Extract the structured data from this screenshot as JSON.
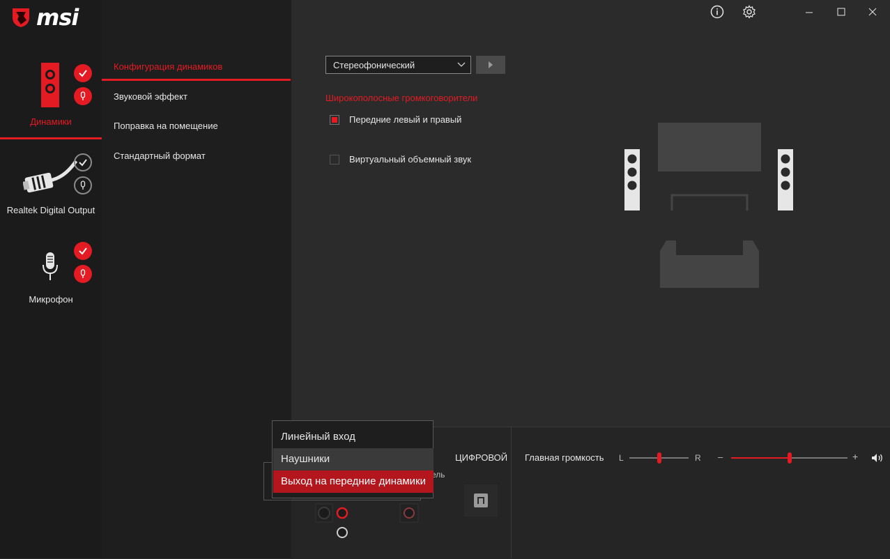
{
  "brand": {
    "logo_text": "msi"
  },
  "window": {
    "info_icon": "info-icon",
    "settings_icon": "gear-icon",
    "minimize": "minimize-icon",
    "maximize": "maximize-icon",
    "close": "close-icon"
  },
  "devices": [
    {
      "label": "Динамики",
      "active": true
    },
    {
      "label": "Realtek Digital Output",
      "active": false
    },
    {
      "label": "Микрофон",
      "active": false
    }
  ],
  "submenu": [
    {
      "label": "Конфигурация динамиков",
      "active": true
    },
    {
      "label": "Звуковой эффект",
      "active": false
    },
    {
      "label": "Поправка на помещение",
      "active": false
    },
    {
      "label": "Стандартный формат",
      "active": false
    }
  ],
  "config": {
    "select_value": "Стереофонический",
    "section_title": "Широкополосные громкоговорители",
    "opt_front": "Передние левый и правый",
    "opt_virtual": "Виртуальный объемный звук"
  },
  "bottom": {
    "digital_label": "ЦИФРОВОЙ",
    "volume_label": "Главная громкость",
    "left_letter": "L",
    "right_letter": "R",
    "minus": "–",
    "plus": "+",
    "partial_label": "ель",
    "balance": 0.5,
    "volume": 0.5
  },
  "context_menu": {
    "items": [
      "Линейный вход",
      "Наушники",
      "Выход на передние динамики"
    ]
  },
  "colors": {
    "accent": "#e41b23"
  }
}
